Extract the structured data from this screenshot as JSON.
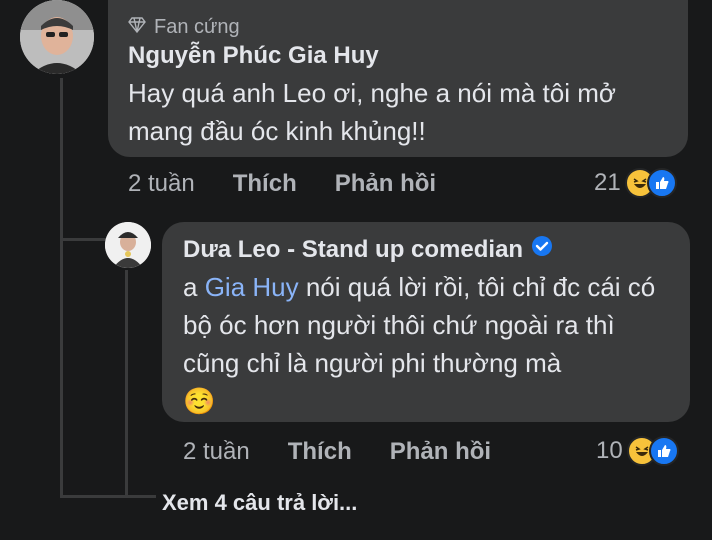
{
  "comment": {
    "badge": "Fan cứng",
    "author": "Nguyễn Phúc Gia Huy",
    "text": "Hay quá anh Leo ơi, nghe a nói mà tôi mở mang đầu óc kinh khủng!!",
    "time": "2 tuần",
    "like_label": "Thích",
    "reply_label": "Phản hồi",
    "reaction_count": "21",
    "reactions": [
      "haha-icon",
      "like-icon"
    ]
  },
  "reply": {
    "author": "Dưa Leo - Stand up comedian",
    "text_prefix": "a ",
    "mention": "Gia Huy",
    "text_rest": " nói quá lời rồi, tôi chỉ đc cái có bộ óc hơn người thôi chứ ngoài ra thì cũng chỉ là người phi thường mà",
    "emoji": "☺️",
    "time": "2 tuần",
    "like_label": "Thích",
    "reply_label": "Phản hồi",
    "reaction_count": "10",
    "reactions": [
      "haha-icon",
      "like-icon"
    ]
  },
  "view_more": "Xem 4 câu trả lời...",
  "colors": {
    "background": "#18191a",
    "bubble": "#3a3b3c",
    "mention": "#8ab4f8",
    "verified": "#1877f2"
  }
}
